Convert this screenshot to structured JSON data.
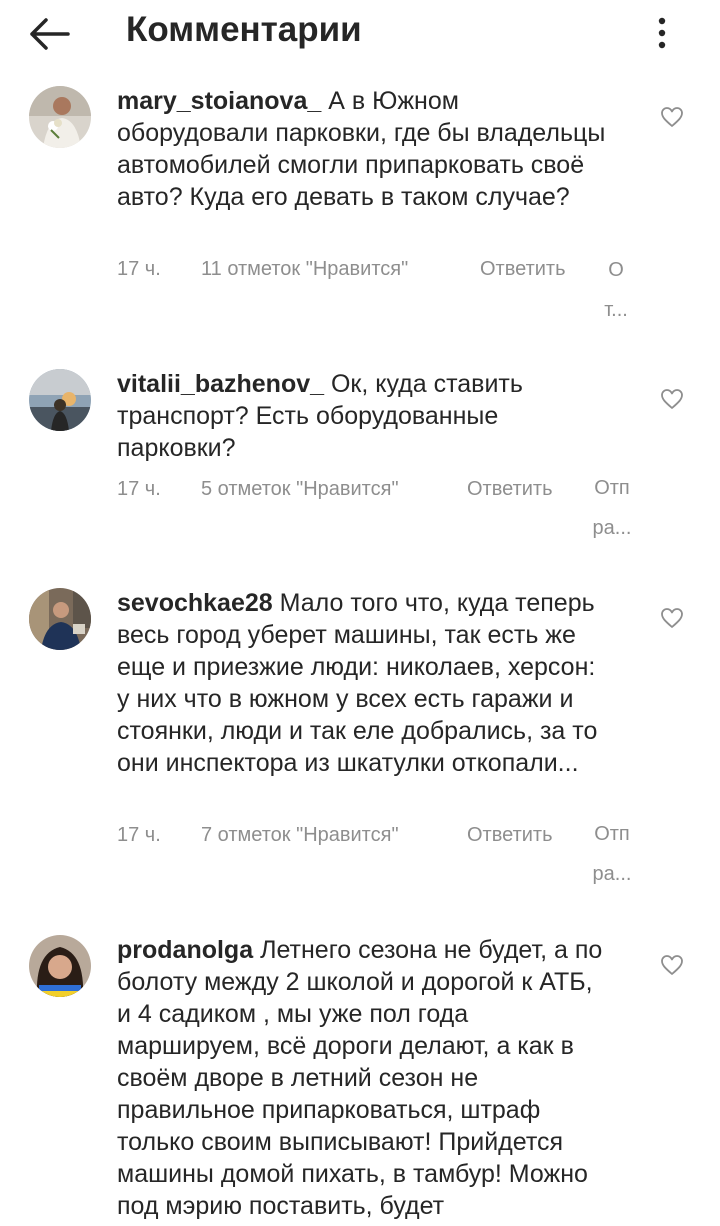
{
  "header": {
    "back_icon": "arrow-left-icon",
    "title": "Комментарии",
    "more_icon": "more-vertical-icon"
  },
  "comments": [
    {
      "username": "mary_stoianova_",
      "text": "А в Южном оборудовали парковки, где бы владельцы автомобилей смогли припарковать своё авто? Куда его девать в таком случае?",
      "time": "17 ч.",
      "likes": "11 отметок \"Нравится\"",
      "reply": "Ответить",
      "send_l1": "О",
      "send_l2": "т..."
    },
    {
      "username": "vitalii_bazhenov_",
      "text": "Ок, куда ставить транспорт? Есть оборудованные парковки?",
      "time": "17 ч.",
      "likes": "5 отметок \"Нравится\"",
      "reply": "Ответить",
      "send_l1": "Отп",
      "send_l2": "ра..."
    },
    {
      "username": "sevochkae28",
      "text": "Мало того что, куда теперь весь город уберет машины, так есть же еще и приезжие люди: николаев, херсон: у них что в южном у всех есть гаражи и стоянки, люди и так еле добрались, за то они инспектора из шкатулки откопали...",
      "time": "17 ч.",
      "likes": "7 отметок \"Нравится\"",
      "reply": "Ответить",
      "send_l1": "Отп",
      "send_l2": "ра..."
    },
    {
      "username": "prodanolga",
      "text": "Летнего сезона не будет, а по болоту между 2 школой и дорогой к АТБ, и 4 садиком , мы уже пол года маршируем, всё дороги делают, а как в своём дворе в летний сезон не правильное припарковаться, штраф только своим выписывают! Прийдется машины домой пихать, в тамбур! Можно под мэрию поставить, будет"
    }
  ],
  "colors": {
    "text": "#262626",
    "meta": "#8e8e8e",
    "background": "#ffffff"
  }
}
